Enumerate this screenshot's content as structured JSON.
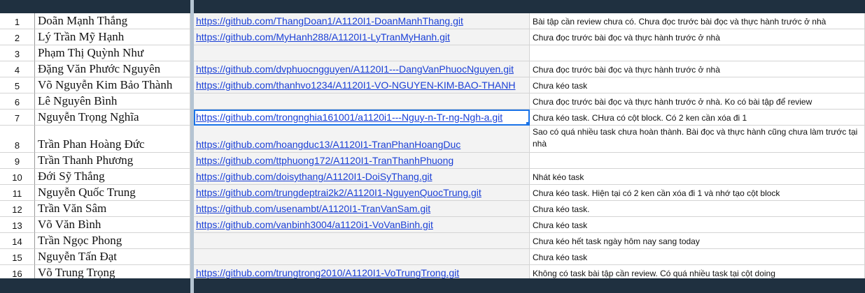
{
  "sheet": {
    "rows": [
      {
        "num": "1",
        "name": "Doãn Mạnh Thắng",
        "link": "https://github.com/ThangDoan1/A1120I1-DoanManhThang.git",
        "note": "Bài tập cần review chưa có. Chưa đọc trước bài đọc và thực hành trước ở nhà"
      },
      {
        "num": "2",
        "name": "Lý Trần Mỹ Hạnh",
        "link": "https://github.com/MyHanh288/A1120I1-LyTranMyHanh.git",
        "note": "Chưa đọc trước bài đọc và thực hành trước ở nhà"
      },
      {
        "num": "3",
        "name": "Phạm Thị Quỳnh Như",
        "link": "",
        "note": ""
      },
      {
        "num": "4",
        "name": "Đặng Văn Phước Nguyên",
        "link": "https://github.com/dvphuocngguyen/A1120I1---DangVanPhuocNguyen.git",
        "note": "Chưa đọc trước bài đọc và thực hành trước ở nhà"
      },
      {
        "num": "5",
        "name": "Võ Nguyễn Kim Bảo Thành",
        "link": "https://github.com/thanhvo1234/A1120I1-VO-NGUYEN-KIM-BAO-THANH",
        "note": "Chưa kéo task"
      },
      {
        "num": "6",
        "name": "Lê Nguyên Bình",
        "link": "",
        "note": "Chưa đọc trước bài đọc và thực hành trước ở nhà. Ko có bài tập để review"
      },
      {
        "num": "7",
        "name": "Nguyễn Trọng Nghĩa",
        "link": "https://github.com/trongnghia161001/a1120i1---Nguy-n-Tr-ng-Ngh-a.git",
        "note": "Chưa kéo task. CHưa có cột block. Có 2 ken cần xóa đi 1",
        "selected": true
      },
      {
        "num": "8",
        "name": "Trần Phan Hoàng Đức",
        "link": "https://github.com/hoangduc13/A1120I1-TranPhanHoangDuc",
        "note": "Sao có quá nhiều task chưa hoàn thành. Bài đọc và thực hành cũng chưa làm trước tại nhà",
        "tall": true
      },
      {
        "num": "9",
        "name": "Trần Thanh Phương",
        "link": "https://github.com/ttphuong172/A1120I1-TranThanhPhuong",
        "note": ""
      },
      {
        "num": "10",
        "name": "Đới Sỹ Thắng",
        "link": "https://github.com/doisythang/A1120I1-DoiSyThang.git",
        "note": "Nhát kéo task"
      },
      {
        "num": "11",
        "name": "Nguyễn Quốc Trung",
        "link": "https://github.com/trungdeptrai2k2/A1120I1-NguyenQuocTrung.git",
        "note": "Chưa kéo task. Hiện tại có 2 ken cần xóa đi 1 và nhớ tạo cột block"
      },
      {
        "num": "12",
        "name": "Trần Văn Sâm",
        "link": "https://github.com/usenambt/A1120I1-TranVanSam.git",
        "note": "Chưa kéo task."
      },
      {
        "num": "13",
        "name": "Võ Văn Bình",
        "link": "https://github.com/vanbinh3004/a1120i1-VoVanBinh.git",
        "note": "Chưa kéo task"
      },
      {
        "num": "14",
        "name": "Trần Ngọc Phong",
        "link": "",
        "note": "Chưa kéo hết task ngày hôm nay sang today"
      },
      {
        "num": "15",
        "name": "Nguyễn Tấn Đạt",
        "link": "",
        "note": "Chưa kéo task"
      },
      {
        "num": "16",
        "name": "Võ Trung Trọng",
        "link": "https://github.com/trungtrong2010/A1120I1-VoTrungTrong.git",
        "note": "Không có task bài tập cần review. Có quá nhiều task tại cột doing"
      }
    ]
  },
  "colors": {
    "header_band": "#1f3040",
    "link": "#1a3fd6",
    "selection": "#1a73e8"
  }
}
